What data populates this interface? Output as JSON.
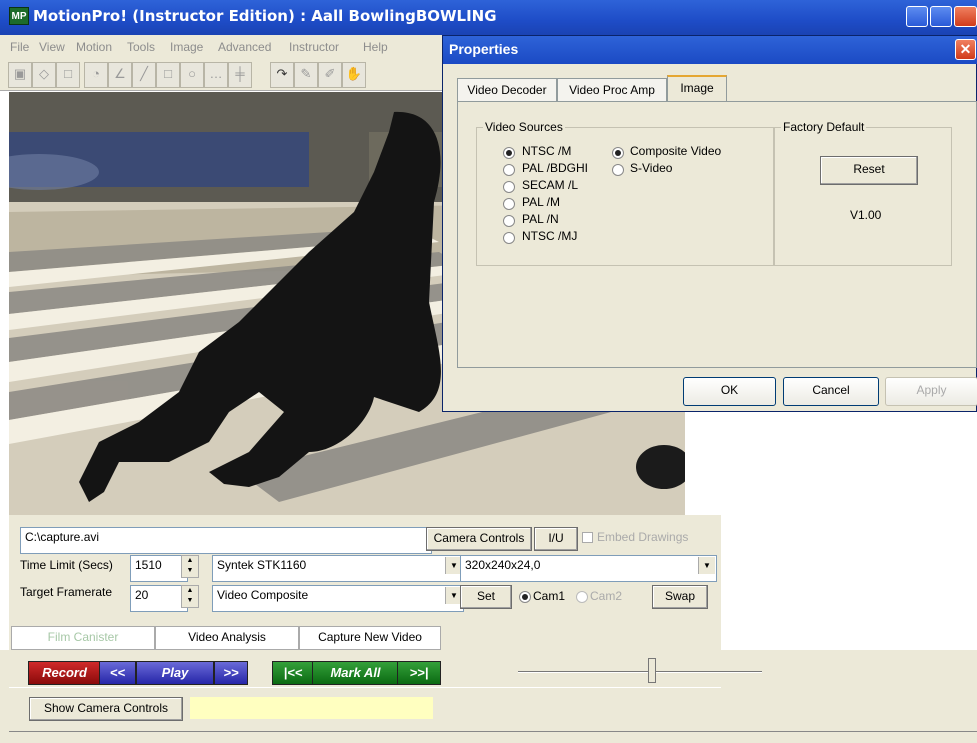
{
  "window": {
    "title": "MotionPro! (Instructor Edition) : Aall BowlingBOWLING",
    "app_icon": "MP"
  },
  "menu": [
    "File",
    "View",
    "Motion",
    "Tools",
    "Image",
    "Advanced",
    "Instructor",
    "Help"
  ],
  "capture": {
    "file_path": "C:\\capture.avi",
    "camera_controls_label": "Camera Controls",
    "io_label": "I/U",
    "embed_drawings_label": "Embed Drawings",
    "time_limit_label": "Time Limit (Secs)",
    "time_limit_value": "1510",
    "device": "Syntek STK1160",
    "format": "320x240x24,0",
    "target_framerate_label": "Target Framerate",
    "target_framerate_value": "20",
    "source": "Video Composite",
    "set_label": "Set",
    "cam1_label": "Cam1",
    "cam2_label": "Cam2",
    "swap_label": "Swap"
  },
  "bottom_tabs": [
    "Film Canister",
    "Video Analysis",
    "Capture New Video"
  ],
  "transport": {
    "record": "Record",
    "rewind": "<<",
    "play": "Play",
    "forward": ">>",
    "first": "|<<",
    "mark_all": "Mark All",
    "last": ">>|",
    "slider_position": 0.55
  },
  "show_camera_controls_label": "Show Camera Controls",
  "dialog": {
    "title": "Properties",
    "tabs": [
      "Video Decoder",
      "Video Proc Amp",
      "Image"
    ],
    "active_tab": "Image",
    "video_sources_label": "Video Sources",
    "standards": [
      "NTSC /M",
      "PAL /BDGHI",
      "SECAM /L",
      "PAL /M",
      "PAL /N",
      "NTSC /MJ"
    ],
    "inputs": [
      "Composite Video",
      "S-Video"
    ],
    "factory_default_label": "Factory Default",
    "reset_label": "Reset",
    "version": "V1.00",
    "ok_label": "OK",
    "cancel_label": "Cancel",
    "apply_label": "Apply"
  },
  "colors": {
    "title_blue": "#1e4cc7",
    "record_red": "#b01818",
    "transport_blue": "#3434b8",
    "transport_green": "#188020",
    "status_yellow": "#ffffc0"
  }
}
